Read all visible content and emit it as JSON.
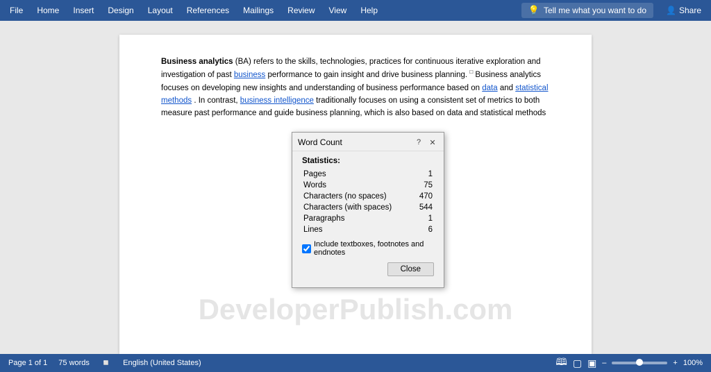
{
  "ribbon": {
    "menu_items": [
      "File",
      "Home",
      "Insert",
      "Design",
      "Layout",
      "References",
      "Mailings",
      "Review",
      "View",
      "Help"
    ],
    "tell_me": "Tell me what you want to do",
    "share": "Share"
  },
  "document": {
    "content": {
      "bold_term": "Business analytics",
      "abbr": "BA",
      "paragraph1": " refers to the skills, technologies, practices for continuous iterative exploration and investigation of past ",
      "link1": "business",
      "paragraph2": " performance to gain insight and drive business planning.",
      "paragraph3": " Business analytics focuses on developing new insights and understanding of business performance based on ",
      "link2": "data",
      "paragraph4": " and ",
      "link3": "statistical methods",
      "paragraph5": ". In contrast, ",
      "link4": "business intelligence",
      "paragraph6": " traditionally focuses on using a consistent set of metrics to both measure past performance and guide business planning, which is also based on data and statistical methods"
    },
    "watermark": "DeveloperPublish.com"
  },
  "word_count_dialog": {
    "title": "Word Count",
    "help_icon": "?",
    "close_icon": "✕",
    "statistics_label": "Statistics:",
    "rows": [
      {
        "label": "Pages",
        "value": "1"
      },
      {
        "label": "Words",
        "value": "75"
      },
      {
        "label": "Characters (no spaces)",
        "value": "470"
      },
      {
        "label": "Characters (with spaces)",
        "value": "544"
      },
      {
        "label": "Paragraphs",
        "value": "1"
      },
      {
        "label": "Lines",
        "value": "6"
      }
    ],
    "checkbox_label": "Include textboxes, footnotes and endnotes",
    "close_button": "Close"
  },
  "status_bar": {
    "page_info": "Page 1 of 1",
    "words": "75 words",
    "language": "English (United States)",
    "zoom": "100%",
    "zoom_minus": "–",
    "zoom_plus": "+"
  }
}
